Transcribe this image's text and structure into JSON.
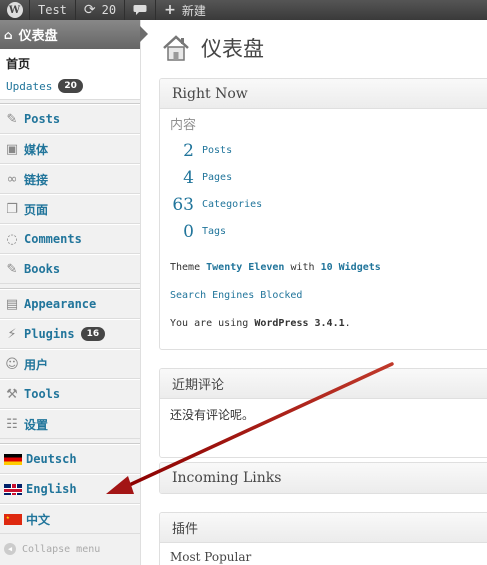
{
  "adminbar": {
    "wp_logo": "W",
    "site_name": "Test",
    "updates_count": "20",
    "new_label": "新建",
    "icons": [
      "wp-logo",
      "refresh-icon",
      "comment-icon",
      "plus-icon"
    ]
  },
  "sidebar": {
    "dashboard_label": "仪表盘",
    "home_label": "首页",
    "updates_label": "Updates",
    "updates_badge": "20",
    "items": [
      {
        "label": "Posts",
        "icon": "pin-icon"
      },
      {
        "label": "媒体",
        "icon": "media-icon"
      },
      {
        "label": "链接",
        "icon": "link-icon"
      },
      {
        "label": "页面",
        "icon": "page-icon"
      },
      {
        "label": "Comments",
        "icon": "comment-icon"
      },
      {
        "label": "Books",
        "icon": "pin-icon"
      }
    ],
    "items2": [
      {
        "label": "Appearance",
        "icon": "appearance-icon"
      },
      {
        "label": "Plugins",
        "icon": "plugin-icon",
        "badge": "16"
      },
      {
        "label": "用户",
        "icon": "users-icon"
      },
      {
        "label": "Tools",
        "icon": "tools-icon"
      },
      {
        "label": "设置",
        "icon": "settings-icon"
      }
    ],
    "languages": [
      {
        "label": "Deutsch",
        "flag": "de"
      },
      {
        "label": "English",
        "flag": "uk"
      },
      {
        "label": "中文",
        "flag": "cn"
      }
    ],
    "collapse_label": "Collapse menu"
  },
  "main": {
    "page_title": "仪表盘",
    "right_now": {
      "title": "Right Now",
      "subtitle": "内容",
      "stats": [
        {
          "num": "2",
          "label": "Posts"
        },
        {
          "num": "4",
          "label": "Pages"
        },
        {
          "num": "63",
          "label": "Categories"
        },
        {
          "num": "0",
          "label": "Tags"
        }
      ],
      "theme_prefix": "Theme",
      "theme_name": "Twenty Eleven",
      "theme_with": "with",
      "widgets": "10 Widgets",
      "search_blocked": "Search Engines Blocked",
      "version_prefix": "You are using",
      "version_name": "WordPress 3.4.1",
      "version_suffix": "."
    },
    "recent_comments": {
      "title": "近期评论",
      "body": "还没有评论呢。"
    },
    "incoming_links": {
      "title": "Incoming Links"
    },
    "plugins": {
      "title": "插件",
      "subtitle": "Most Popular"
    }
  },
  "colors": {
    "link": "#21759b",
    "arrow": "#b22222",
    "adminbar": "#464646"
  }
}
